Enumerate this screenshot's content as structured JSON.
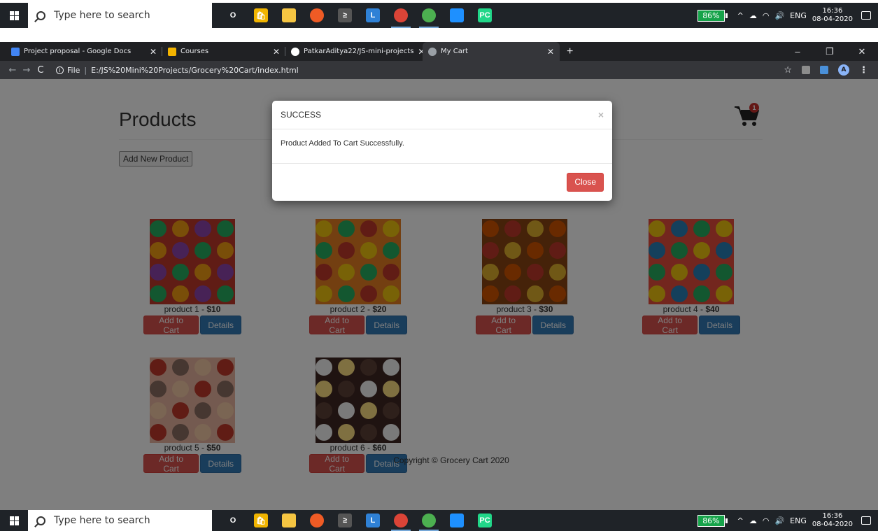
{
  "taskbar": {
    "search_placeholder": "Type here to search",
    "battery": "86%",
    "lang": "ENG",
    "time": "16:36",
    "date": "08-04-2020",
    "apps": [
      {
        "name": "cortana",
        "glyph": "O",
        "color": "transparent"
      },
      {
        "name": "store",
        "glyph": "🛍",
        "color": "#f0b400"
      },
      {
        "name": "file-explorer",
        "glyph": "",
        "color": "#f5c542"
      },
      {
        "name": "postman",
        "glyph": "",
        "color": "#ef5b25"
      },
      {
        "name": "terminal",
        "glyph": "≥",
        "color": "#555"
      },
      {
        "name": "app-l",
        "glyph": "L",
        "color": "#2f81d6"
      },
      {
        "name": "chrome",
        "glyph": "",
        "color": "#db4437"
      },
      {
        "name": "notifier",
        "glyph": "",
        "color": "#4caf50"
      },
      {
        "name": "vscode",
        "glyph": "",
        "color": "#1e90ff"
      },
      {
        "name": "pycharm",
        "glyph": "PC",
        "color": "#21d789"
      }
    ]
  },
  "browser": {
    "tabs": [
      {
        "title": "Project proposal - Google Docs",
        "favicon": "#4285f4"
      },
      {
        "title": "Courses",
        "favicon": "#f4b400"
      },
      {
        "title": "PatkarAditya22/JS-mini-projects",
        "favicon": "#ffffff"
      },
      {
        "title": "My Cart",
        "favicon": "#9aa0a6"
      }
    ],
    "address_prefix": "File",
    "address": "E:/JS%20Mini%20Projects/Grocery%20Cart/index.html",
    "profile_initial": "A"
  },
  "page": {
    "title": "Products",
    "cart_count": "1",
    "add_product_label": "Add New Product",
    "add_to_cart_label": "Add to Cart",
    "details_label": "Details",
    "products": [
      {
        "name": "product 1",
        "price": "$10",
        "colors": [
          "#c0392b",
          "#27ae60",
          "#f39c12",
          "#8e44ad"
        ]
      },
      {
        "name": "product 2",
        "price": "$20",
        "colors": [
          "#e67e22",
          "#f1c40f",
          "#27ae60",
          "#c0392b"
        ]
      },
      {
        "name": "product 3",
        "price": "$30",
        "colors": [
          "#8b4513",
          "#d35400",
          "#c0392b",
          "#e1b12c"
        ]
      },
      {
        "name": "product 4",
        "price": "$40",
        "colors": [
          "#e74c3c",
          "#f1c40f",
          "#2980b9",
          "#27ae60"
        ]
      },
      {
        "name": "product 5",
        "price": "$50",
        "colors": [
          "#e8b4a0",
          "#c0392b",
          "#8d6e63",
          "#f5cba7"
        ]
      },
      {
        "name": "product 6",
        "price": "$60",
        "colors": [
          "#3e2723",
          "#f5f5f5",
          "#ffe082",
          "#5d4037"
        ]
      }
    ],
    "footer": "Copyright © Grocery Cart 2020"
  },
  "modal": {
    "title": "SUCCESS",
    "close_x": "×",
    "message": "Product Added To Cart Successfully.",
    "close_label": "Close"
  }
}
